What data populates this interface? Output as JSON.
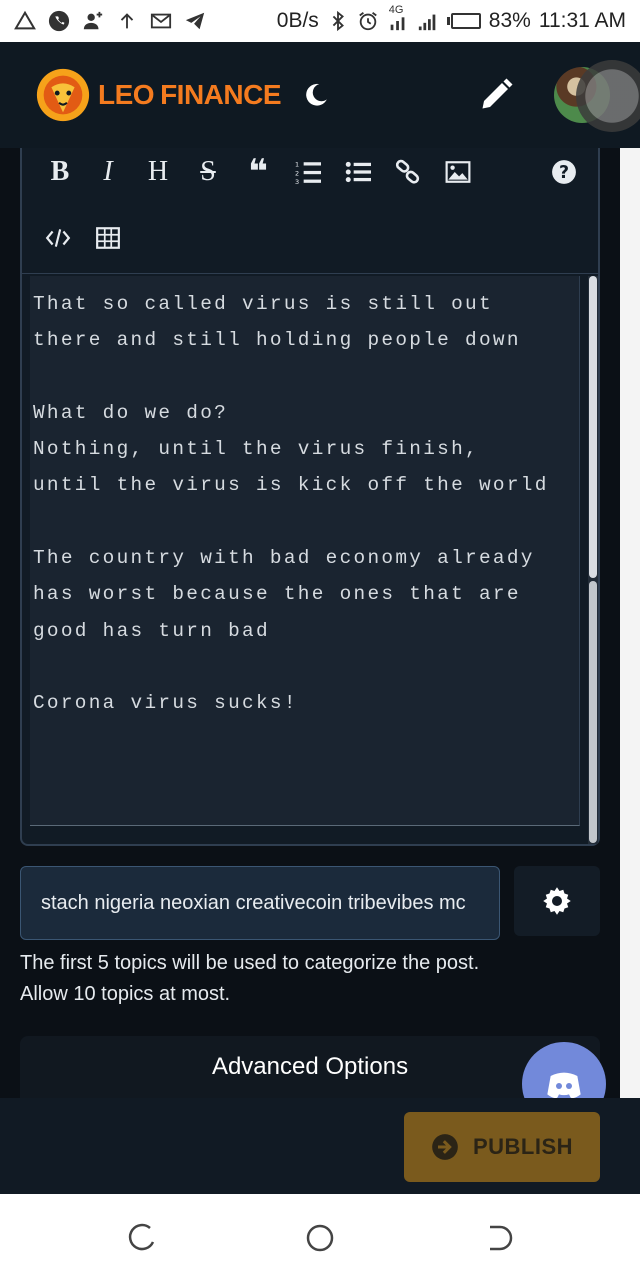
{
  "status_bar": {
    "network_speed": "0B/s",
    "signal_label": "4G",
    "battery_percent": "83%",
    "battery_level": 0.83,
    "time": "11:31 AM",
    "left_icons": [
      "alert-icon",
      "phone-icon",
      "add-person-icon",
      "upload-arrow-icon",
      "gmail-icon",
      "telegram-icon"
    ],
    "right_icons": [
      "bluetooth-icon",
      "alarm-icon",
      "cell-signal-icon",
      "wifi-signal-icon",
      "battery-icon"
    ]
  },
  "header": {
    "logo_text_1": "LEO",
    "logo_text_2": "FINANCE",
    "logo_color": "#f47b1f",
    "background": "#0f1922",
    "icons": [
      "lion-logo-icon",
      "moon-icon",
      "pencil-icon",
      "avatar"
    ]
  },
  "editor": {
    "toolbar": {
      "bold": "B",
      "italic": "I",
      "heading": "H",
      "strike": "S",
      "quote": "❝",
      "icons": [
        "ordered-list-icon",
        "unordered-list-icon",
        "link-icon",
        "image-icon",
        "help-icon",
        "code-icon",
        "table-icon"
      ]
    },
    "body_lines": [
      "That so called virus is still out",
      "there and still holding people down",
      "",
      "What do we do?",
      "Nothing, until the virus finish,",
      "until the virus is kick off the world",
      "",
      "The country with bad economy already",
      "has worst because the ones that are",
      "good has turn bad",
      "",
      "Corona virus sucks!"
    ]
  },
  "tags": {
    "value": "stach nigeria neoxian creativecoin tribevibes mc",
    "hint": "The first 5 topics will be used to categorize the post. Allow 10 topics at most."
  },
  "advanced": {
    "label": "Advanced Options"
  },
  "publish": {
    "label": "PUBLISH",
    "color": "#7a5a1d"
  },
  "nav": {
    "icons": [
      "recents-icon",
      "home-icon",
      "back-icon"
    ]
  }
}
